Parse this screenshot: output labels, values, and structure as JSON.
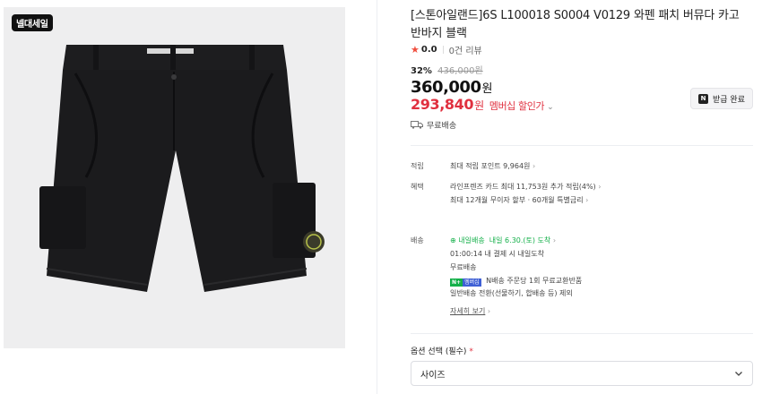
{
  "image": {
    "badge": "넬대세일",
    "alt": "black cargo shorts"
  },
  "product": {
    "title": "[스톤아일랜드]6S L100018 S0004 V0129 와펜 패치 버뮤다 카고 반바지 블랙",
    "rating_score": "0.0",
    "review_count": "0건 리뷰",
    "discount_pct": "32%",
    "original_price": "436,000원",
    "price": "360,000",
    "price_unit": "원",
    "member_price": "293,840",
    "member_price_unit": "원",
    "member_label": "멤버십 할인가",
    "coupon_button": "받급 완료",
    "shipping_free": "무료배송"
  },
  "benefits": {
    "points_key": "적립",
    "points_value": "최대 적립 포인트 9,964원",
    "benefit_key": "혜택",
    "benefit_line1": "라인프렌즈 카드 최대 11,753원 추가 적립(4%)",
    "benefit_line2": "최대 12개월 무이자 할부 · 60개월 특별금리"
  },
  "delivery": {
    "key": "배송",
    "tomorrow_badge": "내일배송",
    "arrival": "내일 6.30.(토) 도착",
    "cutoff": "01:00:14  내 결제 시 내일도착",
    "fee": "무료배송",
    "badge_n": "N+",
    "badge_member": "멤버십",
    "exchange": "N배송 주문당 1회 무료교환반품",
    "normal_conversion": "일반배송 전환(선물하기, 합배송 등) 제외",
    "details_link": "자세히 보기"
  },
  "options": {
    "label": "옵션 선택 (필수)",
    "required_mark": "*",
    "select_value": "사이즈"
  },
  "colors": {
    "accent_red": "#e0303f",
    "link_blue": "#4a5fc9",
    "delivery_green": "#14b04a"
  }
}
